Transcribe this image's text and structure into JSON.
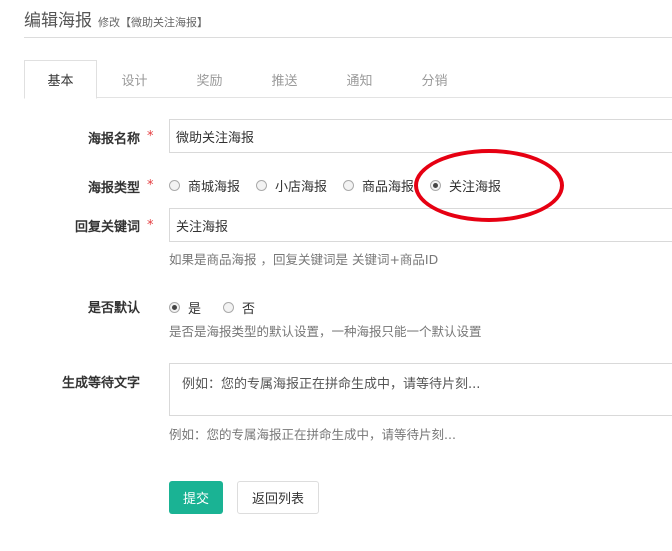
{
  "header": {
    "title": "编辑海报",
    "subtitle": "修改【微助关注海报】"
  },
  "tabs": [
    {
      "label": "基本",
      "active": true
    },
    {
      "label": "设计",
      "active": false
    },
    {
      "label": "奖励",
      "active": false
    },
    {
      "label": "推送",
      "active": false
    },
    {
      "label": "通知",
      "active": false
    },
    {
      "label": "分销",
      "active": false
    }
  ],
  "form": {
    "poster_name": {
      "label": "海报名称",
      "required_mark": "*",
      "value": "微助关注海报"
    },
    "poster_type": {
      "label": "海报类型",
      "required_mark": "*",
      "options": [
        "商城海报",
        "小店海报",
        "商品海报",
        "关注海报"
      ],
      "selected": "关注海报"
    },
    "reply_keyword": {
      "label": "回复关键词",
      "required_mark": "*",
      "value": "关注海报",
      "help": "如果是商品海报 ，回复关键词是 关键词+商品ID"
    },
    "is_default": {
      "label": "是否默认",
      "options": [
        "是",
        "否"
      ],
      "selected": "是",
      "help": "是否是海报类型的默认设置，一种海报只能一个默认设置"
    },
    "waiting_text": {
      "label": "生成等待文字",
      "placeholder": "例如：您的专属海报正在拼命生成中，请等待片刻...",
      "help": "例如：您的专属海报正在拼命生成中，请等待片刻..."
    }
  },
  "buttons": {
    "submit": "提交",
    "back": "返回列表"
  },
  "colors": {
    "primary": "#1ab394",
    "required": "#e4393c",
    "annotation": "#e60012"
  }
}
